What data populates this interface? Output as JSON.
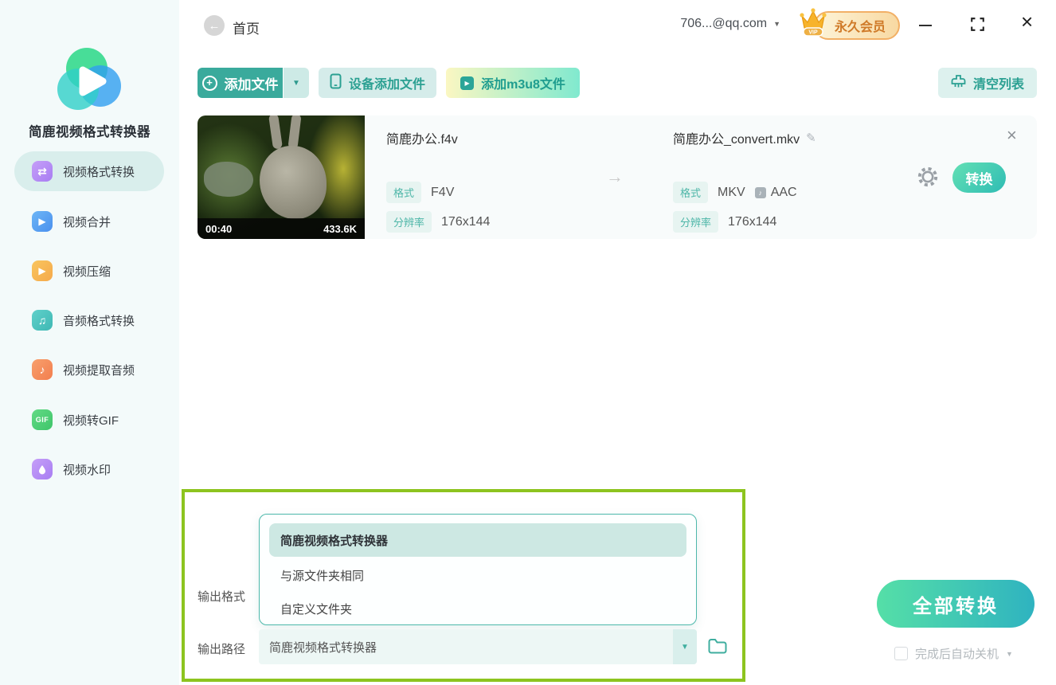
{
  "header": {
    "back_label": "首页",
    "account": "706...@qq.com",
    "vip_label": "永久会员",
    "vip_tag": "VIP"
  },
  "sidebar": {
    "app_name": "简鹿视频格式转换器",
    "items": [
      {
        "label": "视频格式转换",
        "active": true
      },
      {
        "label": "视频合并",
        "active": false
      },
      {
        "label": "视频压缩",
        "active": false
      },
      {
        "label": "音频格式转换",
        "active": false
      },
      {
        "label": "视频提取音频",
        "active": false
      },
      {
        "label": "视频转GIF",
        "active": false
      },
      {
        "label": "视频水印",
        "active": false
      }
    ]
  },
  "toolbar": {
    "add_file": "添加文件",
    "device_add": "设备添加文件",
    "add_m3u8": "添加m3u8文件",
    "clear_list": "清空列表"
  },
  "file_item": {
    "duration": "00:40",
    "size": "433.6K",
    "source": {
      "name": "简鹿办公.f4v",
      "format_label": "格式",
      "format": "F4V",
      "resolution_label": "分辨率",
      "resolution": "176x144"
    },
    "target": {
      "name": "简鹿办公_convert.mkv",
      "format_label": "格式",
      "format": "MKV",
      "audio_codec": "AAC",
      "resolution_label": "分辨率",
      "resolution": "176x144"
    },
    "convert_button": "转换"
  },
  "output": {
    "format_label": "输出格式",
    "path_label": "输出路径",
    "path_value": "简鹿视频格式转换器",
    "dropdown_options": [
      "简鹿视频格式转换器",
      "与源文件夹相同",
      "自定义文件夹"
    ],
    "selected_option": "简鹿视频格式转换器"
  },
  "footer": {
    "convert_all": "全部转换",
    "shutdown_label": "完成后自动关机"
  },
  "icons": {
    "gif_icon_text": "GIF"
  },
  "colors": {
    "accent_teal": "#3aaa9c",
    "light_teal_button": "#d5ecea",
    "sidebar_bg": "#f3fafa",
    "active_item_bg": "#d9eeec",
    "annotation_green": "#8dc41f",
    "vip_gold": "#f2b066",
    "convert_gradient_start": "#55dfa7",
    "convert_gradient_end": "#2fb3c0"
  }
}
